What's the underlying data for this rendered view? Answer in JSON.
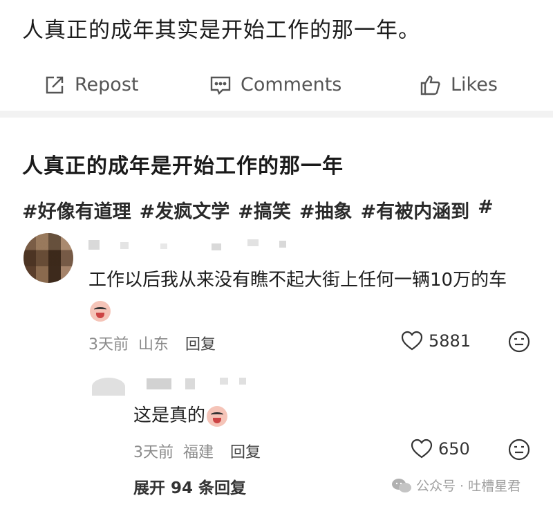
{
  "post": {
    "text": "人真正的成年其实是开始工作的那一年。"
  },
  "actions": {
    "repost_label": "Repost",
    "comments_label": "Comments",
    "likes_label": "Likes"
  },
  "quoted": {
    "title": "人真正的成年是开始工作的那一年",
    "tags": [
      "#好像有道理",
      "#发疯文学",
      "#搞笑",
      "#抽象",
      "#有被内涵到",
      "#"
    ]
  },
  "comments": [
    {
      "text": "工作以后我从来没有瞧不起大街上任何一辆10万的车",
      "time": "3天前",
      "location": "山东",
      "reply_label": "回复",
      "likes": "5881",
      "reply": {
        "text": "这是真的",
        "time": "3天前",
        "location": "福建",
        "reply_label": "回复",
        "likes": "650"
      },
      "expand_label": "展开 94 条回复"
    }
  ],
  "watermark": {
    "text": "公众号 · 吐槽星君"
  },
  "colors": {
    "divider": "#f2f2f2",
    "meta_text": "#8a8a8a",
    "emoji": "#f5c4b8"
  }
}
